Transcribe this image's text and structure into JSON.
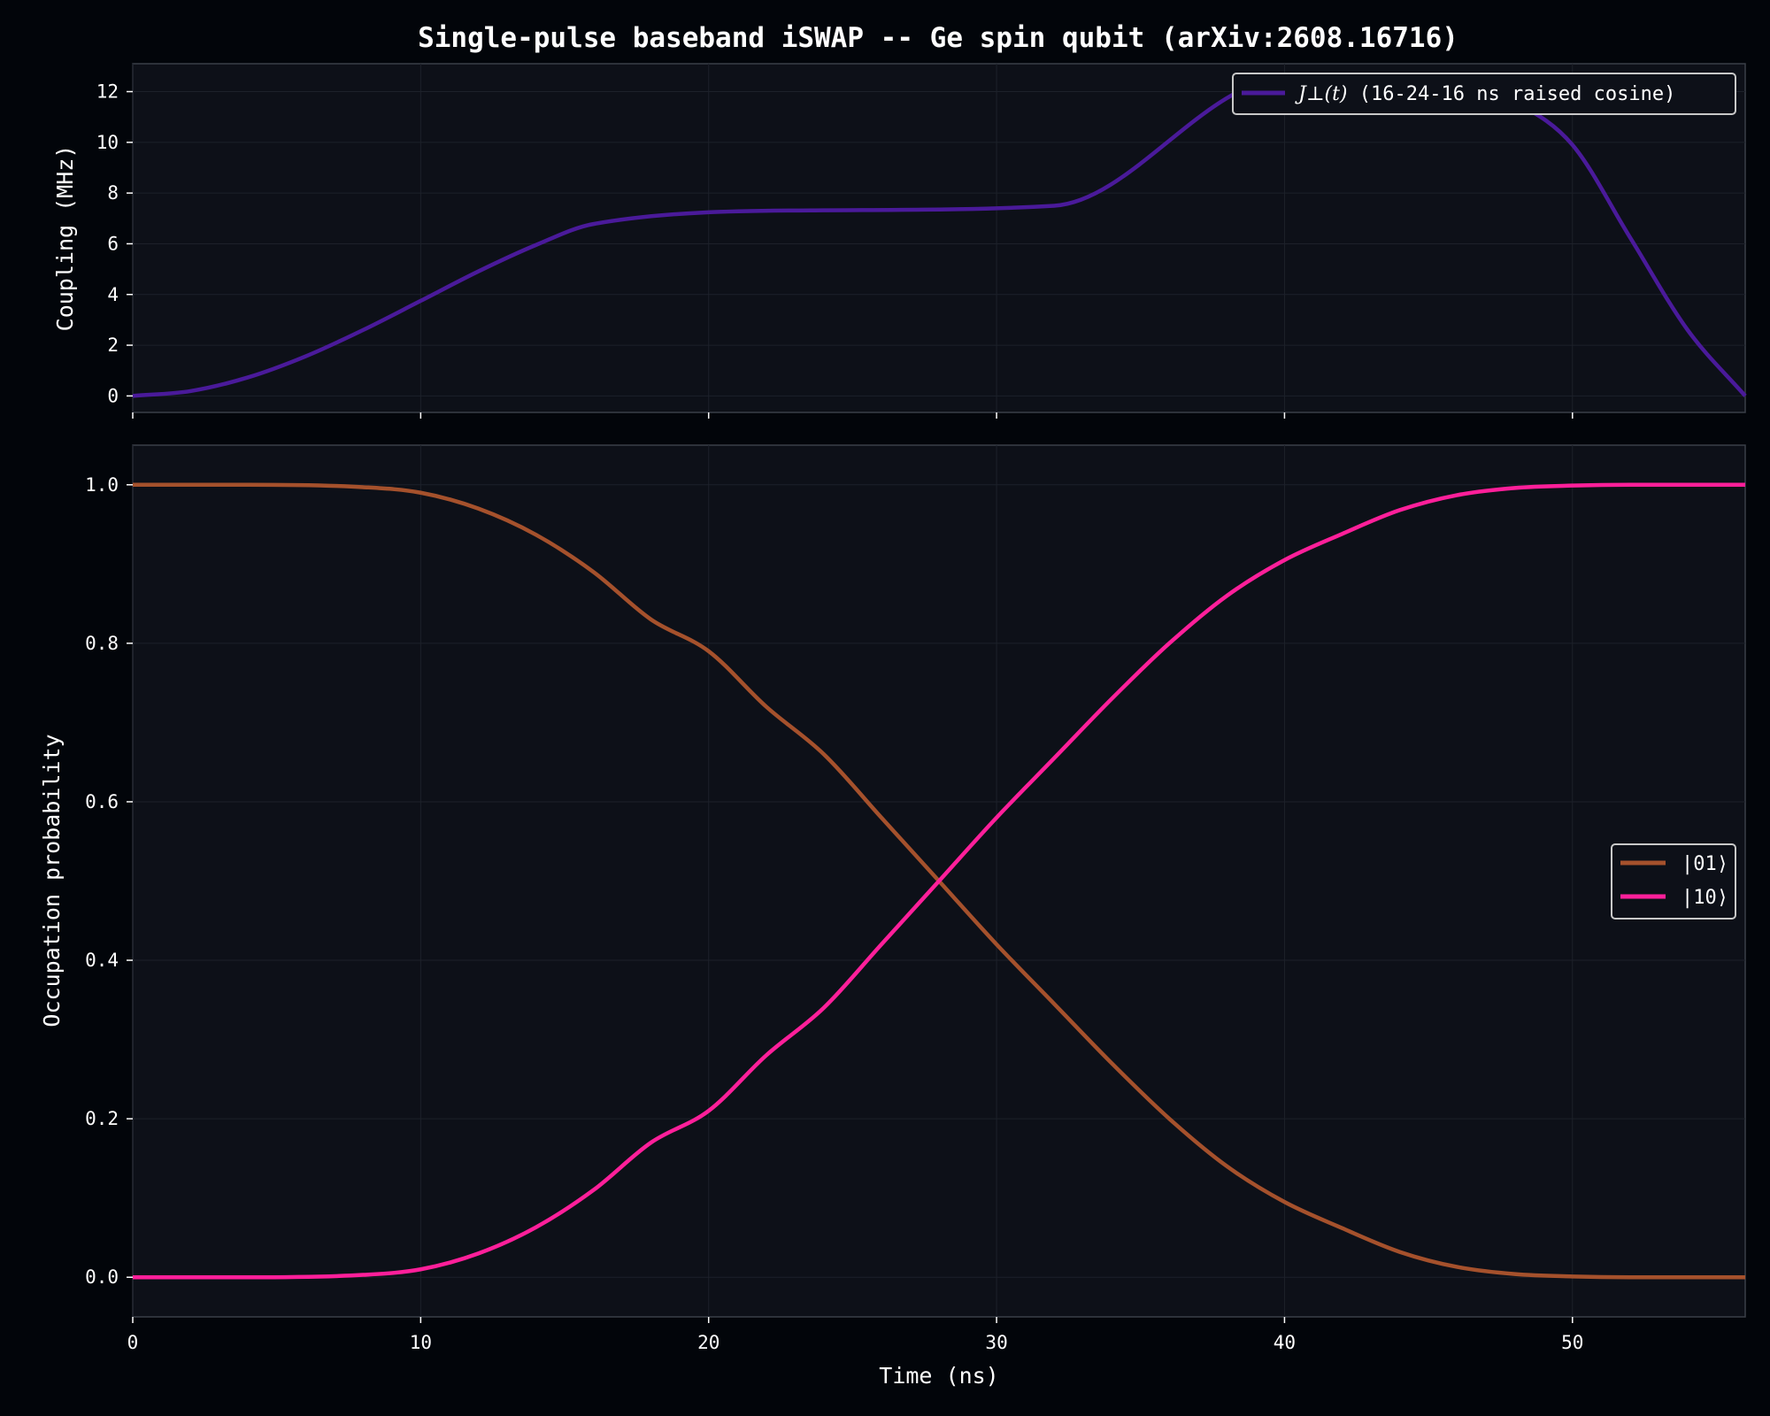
{
  "title": "Single-pulse baseband iSWAP -- Ge spin qubit (arXiv:2608.16716)",
  "colors": {
    "background": "#02050a",
    "axes_face": "#0d1018",
    "coupling": "#4a1a9a",
    "state_01": "#a5512c",
    "state_10": "#ff1f9a"
  },
  "chart_data": [
    {
      "type": "line",
      "panel": "top",
      "ylabel": "Coupling (MHz)",
      "xlim": [
        0,
        56
      ],
      "ylim": [
        -0.65,
        13.1
      ],
      "yticks": [
        0,
        2,
        4,
        6,
        8,
        10,
        12
      ],
      "xticks": [
        0,
        10,
        20,
        30,
        40,
        50
      ],
      "grid": true,
      "legend_position": "upper right",
      "series": [
        {
          "name_math": "J⊥(t)",
          "name_suffix": " (16-24-16 ns raised cosine)",
          "color": "#4a1a9a",
          "x": [
            0,
            2,
            4,
            6,
            8,
            10,
            12,
            14,
            16,
            24,
            32,
            40,
            42,
            44,
            46,
            48,
            50,
            52,
            54,
            56
          ],
          "y": [
            0,
            0.19,
            0.73,
            1.56,
            2.6,
            3.75,
            4.91,
            5.95,
            6.78,
            7.32,
            7.5,
            12.5,
            12.5,
            12.5,
            12.5,
            11.6,
            9.9,
            6.25,
            2.6,
            0
          ]
        }
      ]
    },
    {
      "type": "line",
      "panel": "bottom",
      "xlabel": "Time (ns)",
      "ylabel": "Occupation probability",
      "xlim": [
        0,
        56
      ],
      "ylim": [
        -0.05,
        1.05
      ],
      "xticks": [
        0,
        10,
        20,
        30,
        40,
        50
      ],
      "yticks": [
        0.0,
        0.2,
        0.4,
        0.6,
        0.8,
        1.0
      ],
      "ytick_labels": [
        "0.0",
        "0.2",
        "0.4",
        "0.6",
        "0.8",
        "1.0"
      ],
      "grid": true,
      "legend_position": "center right",
      "series": [
        {
          "name": "|01⟩",
          "color": "#a5512c",
          "x": [
            0,
            4,
            8,
            10,
            12,
            14,
            16,
            18,
            20,
            22,
            24,
            26,
            28,
            30,
            32,
            34,
            36,
            38,
            40,
            42,
            44,
            46,
            48,
            50,
            52,
            56
          ],
          "y": [
            1.0,
            1.0,
            0.997,
            0.99,
            0.97,
            0.937,
            0.89,
            0.83,
            0.79,
            0.72,
            0.66,
            0.58,
            0.5,
            0.42,
            0.345,
            0.27,
            0.2,
            0.14,
            0.095,
            0.062,
            0.032,
            0.013,
            0.004,
            0.001,
            0.0,
            0.0
          ]
        },
        {
          "name": "|10⟩",
          "color": "#ff1f9a",
          "x": [
            0,
            4,
            8,
            10,
            12,
            14,
            16,
            18,
            20,
            22,
            24,
            26,
            28,
            30,
            32,
            34,
            36,
            38,
            40,
            42,
            44,
            46,
            48,
            50,
            52,
            56
          ],
          "y": [
            0.0,
            0.0,
            0.003,
            0.01,
            0.03,
            0.063,
            0.11,
            0.17,
            0.21,
            0.28,
            0.34,
            0.42,
            0.5,
            0.58,
            0.655,
            0.73,
            0.8,
            0.86,
            0.905,
            0.938,
            0.968,
            0.987,
            0.996,
            0.999,
            1.0,
            1.0
          ]
        }
      ]
    }
  ]
}
